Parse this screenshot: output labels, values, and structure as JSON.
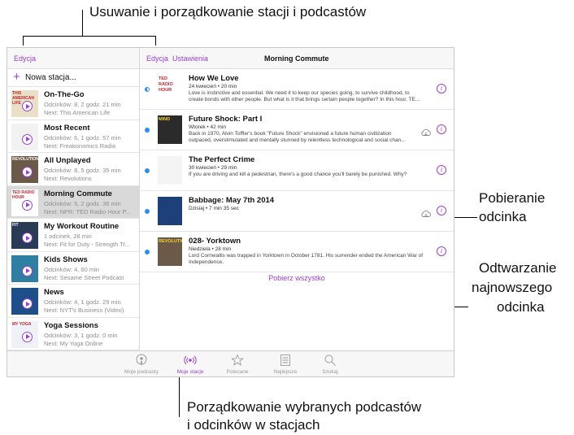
{
  "callouts": {
    "top": "Usuwanie i porządkowanie stacji i podcastów",
    "download_1": "Pobieranie",
    "download_2": "odcinka",
    "play_1": "Odtwarzanie",
    "play_2": "najnowszego",
    "play_3": "odcinka",
    "bottom_1": "Porządkowanie wybranych podcastów",
    "bottom_2": "i odcinków w stacjach"
  },
  "sidebar": {
    "edit_label": "Edycja",
    "new_station_icon": "plus-icon",
    "new_station_label": "Nowa stacja...",
    "stations": [
      {
        "title": "On-The-Go",
        "meta": "Odcinków: 8, 2 godz. 21 min",
        "next": "Next: This American Life",
        "art_text": "THIS AMERICAN LIFE",
        "art_color": "#e9e0c8",
        "selected": false
      },
      {
        "title": "Most Recent",
        "meta": "Odcinków: 6, 1 godz. 57 min",
        "next": "Next: Freakonomics Radio",
        "art_text": "",
        "art_color": "#f2f2f2",
        "selected": false
      },
      {
        "title": "All Unplayed",
        "meta": "Odcinków: 8, 5 godz. 35 min",
        "next": "Next: Revolutions",
        "art_text": "REVOLUTIONS",
        "art_color": "#6b5a48",
        "selected": false
      },
      {
        "title": "Morning Commute",
        "meta": "Odcinków: 5, 2 godz. 36 min",
        "next": "Next: NPR: TED Radio Hour P...",
        "art_text": "TED RADIO HOUR",
        "art_color": "#ffffff",
        "selected": true
      },
      {
        "title": "My Workout Routine",
        "meta": "1 odcinek, 28 min",
        "next": "Next: Fit for Duty - Strength Tr...",
        "art_text": "FIT",
        "art_color": "#2a3b55",
        "selected": false
      },
      {
        "title": "Kids Shows",
        "meta": "Odcinków: 4, 60 min",
        "next": "Next: Sesame Street Podcast",
        "art_text": "",
        "art_color": "#2f7fa3",
        "selected": false
      },
      {
        "title": "News",
        "meta": "Odcinków: 4, 1 godz. 29 min",
        "next": "Next: NYT's Business (Video)",
        "art_text": "",
        "art_color": "#1f4f8a",
        "selected": false
      },
      {
        "title": "Yoga Sessions",
        "meta": "Odcinków: 3, 1 godz. 0 min",
        "next": "Next: My Yoga Online",
        "art_text": "MY YOGA",
        "art_color": "#eef2f6",
        "selected": false
      }
    ]
  },
  "detail": {
    "edit_label": "Edycja",
    "settings_label": "Ustawienia",
    "title": "Morning Commute",
    "download_all_label": "Pobierz wszystko",
    "episodes": [
      {
        "title": "How We Love",
        "meta": "24 kwiecień • 20 min",
        "desc1": "Love is instinctive and essential. We need it to keep our species going, to survive childhood, to",
        "desc2": "create bonds with other people. But what is it that brings certain people together? In this hour, TE...",
        "dot": "half",
        "cloud": false,
        "art_text": "TED RADIO HOUR",
        "art_color": "#ffffff"
      },
      {
        "title": "Future Shock: Part I",
        "meta": "Wtorek • 42 min",
        "desc1": "Back in 1970, Alvin Toffler's book \"Future Shock\" envisioned a future human civilization",
        "desc2": "outpaced, overstimulated and mentally stunned by relentless technological and social chan...",
        "dot": "full",
        "cloud": true,
        "art_text": "MIND",
        "art_color": "#2b2b2b"
      },
      {
        "title": "The Perfect Crime",
        "meta": "30 kwiecień • 29 min",
        "desc1": "If you are driving and kill a pedestrian, there's a good chance you'll barely be punished. Why?",
        "desc2": "",
        "dot": "full",
        "cloud": false,
        "art_text": "",
        "art_color": "#f4f4f4"
      },
      {
        "title": "Babbage: May 7th 2014",
        "meta": "Dzisiaj • 7 min 35 sec",
        "desc1": "",
        "desc2": "",
        "dot": "full",
        "cloud": true,
        "art_text": "",
        "art_color": "#1d3f7a"
      },
      {
        "title": "028- Yorktown",
        "meta": "Niedziela • 28 min",
        "desc1": "Lord Cornwallis was trapped in Yorktown in October 1781. His surrender ended the American War of",
        "desc2": "Independence.",
        "dot": "full",
        "cloud": false,
        "art_text": "REVOLUTIONS",
        "art_color": "#6b5a48"
      }
    ]
  },
  "tabbar": {
    "tabs": [
      {
        "label": "Moje podcasty",
        "icon": "podcast-icon",
        "active": false
      },
      {
        "label": "Moje stacje",
        "icon": "radio-waves-icon",
        "active": true
      },
      {
        "label": "Polecane",
        "icon": "star-icon",
        "active": false
      },
      {
        "label": "Najlepsze",
        "icon": "list-icon",
        "active": false
      },
      {
        "label": "Szukaj",
        "icon": "search-icon",
        "active": false
      }
    ]
  },
  "colors": {
    "accent": "#9b3fd0",
    "unplayed_dot": "#2d8ef0",
    "selected_row": "#d9d9d9"
  }
}
